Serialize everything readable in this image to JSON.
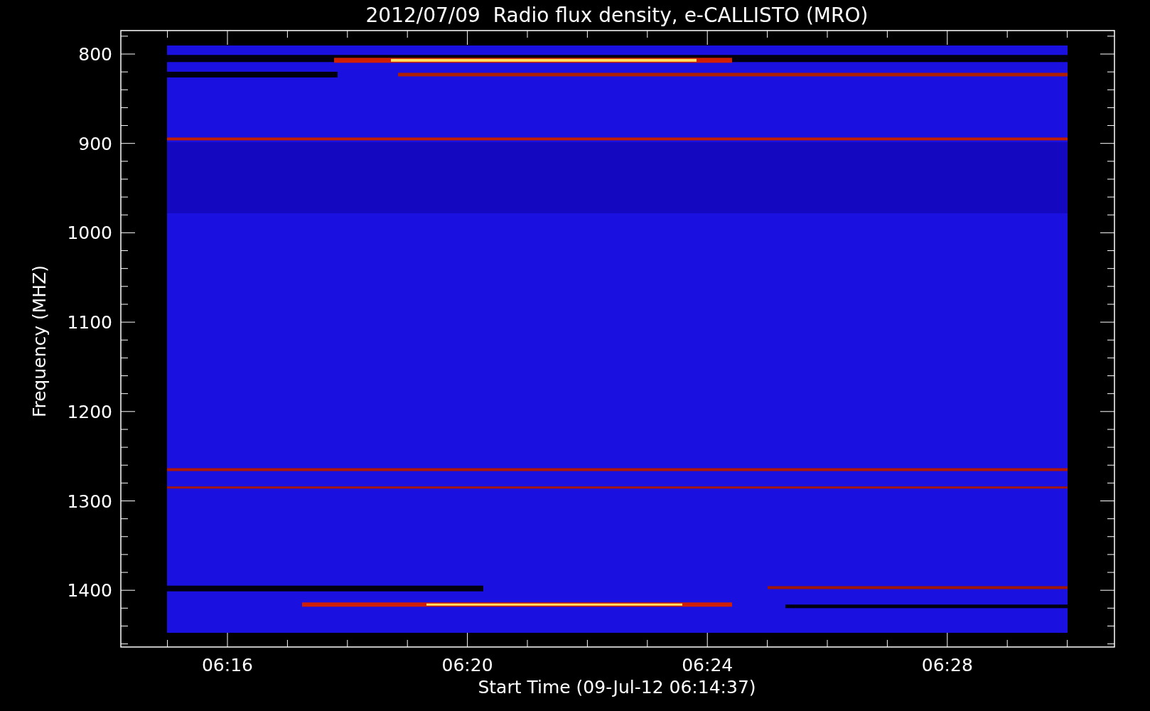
{
  "title": "2012/07/09  Radio flux density, e-CALLISTO (MRO)",
  "y_axis": {
    "label": "Frequency (MHZ)",
    "ticks": [
      "800",
      "900",
      "1000",
      "1100",
      "1200",
      "1300",
      "1400"
    ]
  },
  "x_axis": {
    "label": "Start Time (09-Jul-12 06:14:37)",
    "ticks": [
      "06:16",
      "06:20",
      "06:24",
      "06:28"
    ]
  }
}
